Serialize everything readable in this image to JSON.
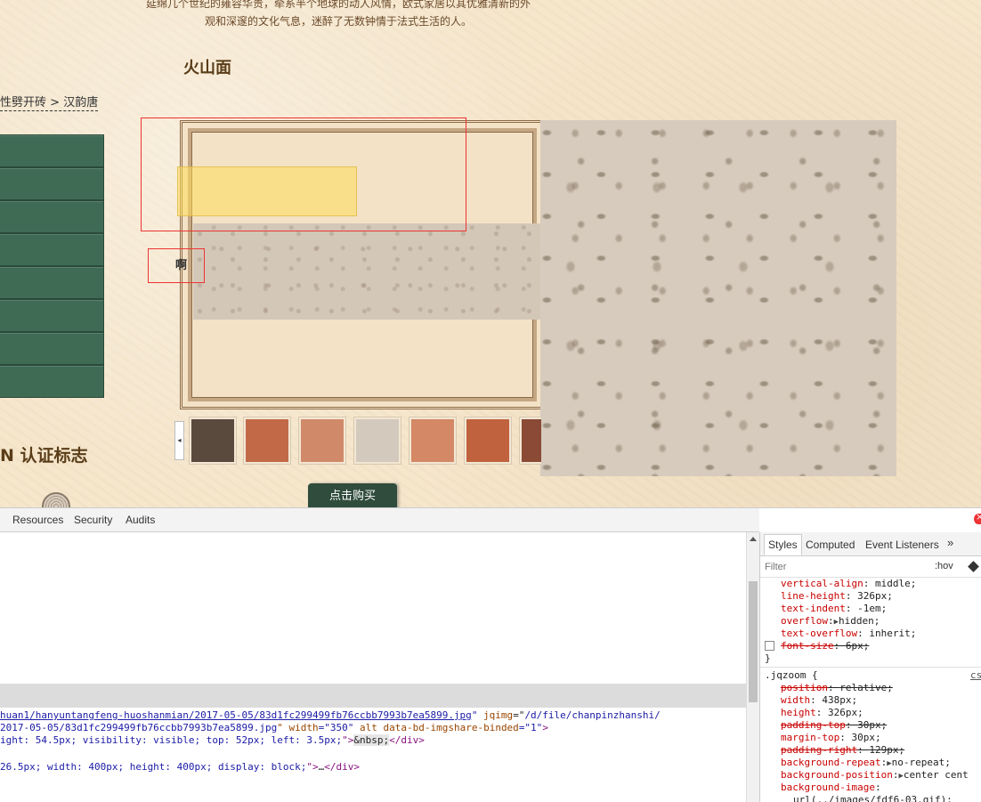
{
  "page": {
    "intro_line1": "延绵几个世纪的雍容华贵，牵系半个地球的动人风情，欧式家居以其优雅清新的外",
    "intro_line2": "观和深邃的文化气息，迷醉了无数钟情于法式生活的人。",
    "product_title": "火山面",
    "breadcrumb": {
      "prefix": "性劈开砖",
      "separator": ">",
      "current": "汉韵唐"
    },
    "category_items": [
      "",
      "",
      "",
      "",
      "",
      "",
      "",
      ""
    ],
    "gallery_overlay_label": "啊",
    "cert_title": "N  认证标志",
    "buy_button": "点击购买",
    "thumb_prev_arrow": "◂",
    "thumbnails": [
      {
        "name": "interior",
        "color": "#5a4a3e"
      },
      {
        "name": "terracotta-1",
        "color": "#c26a48"
      },
      {
        "name": "terracotta-2",
        "color": "#d08a6a"
      },
      {
        "name": "beige-stone",
        "color": "#d3c9bd"
      },
      {
        "name": "terracotta-3",
        "color": "#d48866"
      },
      {
        "name": "terracotta-4",
        "color": "#c0623e"
      },
      {
        "name": "brown",
        "color": "#8a4a36"
      }
    ]
  },
  "devtools": {
    "tabs": [
      "Resources",
      "Security",
      "Audits"
    ],
    "elements_lines": {
      "l1_url": "huan1/hanyuntangfeng-huoshanmian/2017-05-05/83d1fc299499fb76ccbb7993b7ea5899.jpg",
      "l1_quote_close": "\"",
      "l1_attr": " jqimg",
      "l1_eq": "=\"",
      "l1_val": "/d/file/chanpinzhanshi/",
      "l2_val1": "2017-05-05/83d1fc299499fb76ccbb7993b7ea5899.jpg",
      "l2_attr1": "\" width",
      "l2_val2": "=\"350\"",
      "l2_attr2": " alt data-bd-imgshare-binded",
      "l2_val3": "=\"1\"",
      "l2_end": ">",
      "l3_text": "ight: 54.5px; visibility: visible; top: 52px; left: 3.5px;",
      "l3_close": "\">",
      "l3_nbsp": "&nbsp;",
      "l3_tag": "</div>",
      "l4_text": "26.5px; width: 400px; height: 400px; display: block;",
      "l4_close": "\">",
      "l4_ellipsis": "…",
      "l4_tag": "</div>"
    },
    "styles_panel": {
      "tabs": [
        "Styles",
        "Computed",
        "Event Listeners"
      ],
      "more": "»",
      "filter_placeholder": "Filter",
      "hov": ":hov",
      "rule1": [
        {
          "name": "vertical-align",
          "value": "middle;"
        },
        {
          "name": "line-height",
          "value": "326px;"
        },
        {
          "name": "text-indent",
          "value": "-1em;"
        },
        {
          "name": "overflow",
          "value": "hidden;",
          "expand": "▶"
        },
        {
          "name": "text-overflow",
          "value": "inherit;"
        },
        {
          "name": "font-size",
          "value": "6px;",
          "struck": true,
          "checkbox": true
        }
      ],
      "rule1_close": "}",
      "rule2_selector": ".jqzoom {",
      "rule2_source": "cs",
      "rule2": [
        {
          "name": "position",
          "value": "relative;",
          "struck": true
        },
        {
          "name": "width",
          "value": "438px;"
        },
        {
          "name": "height",
          "value": "326px;"
        },
        {
          "name": "padding-top",
          "value": "30px;",
          "struck": true
        },
        {
          "name": "margin-top",
          "value": "30px;"
        },
        {
          "name": "padding-right",
          "value": "129px;",
          "struck": true
        },
        {
          "name": "background-repeat",
          "value": "no-repeat;",
          "expand": "▶"
        },
        {
          "name": "background-position",
          "value": "center cent",
          "expand": "▶"
        },
        {
          "name": "background-image",
          "value": ""
        },
        {
          "name": "",
          "value": "url(../images/fdf6-03.gif);"
        }
      ]
    }
  }
}
